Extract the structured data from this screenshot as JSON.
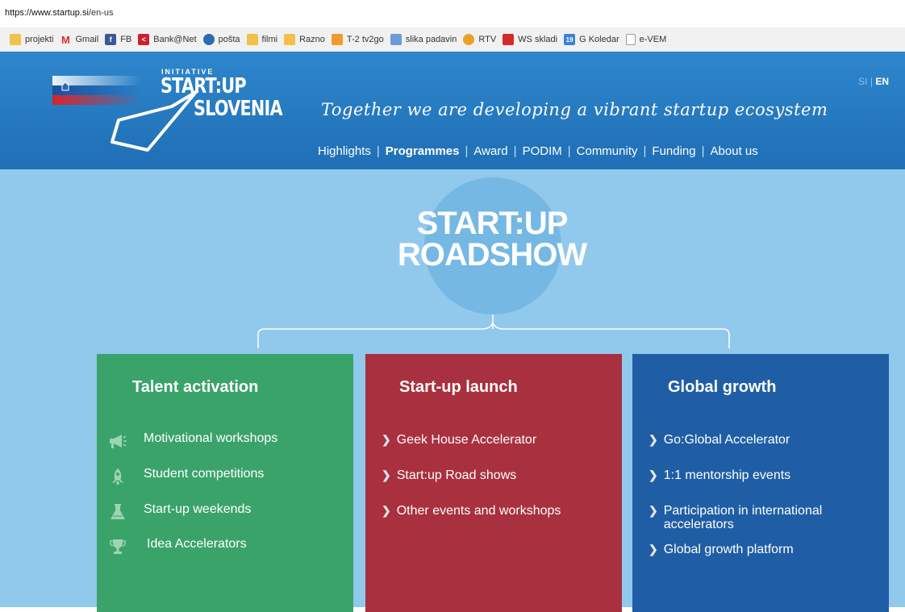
{
  "browser": {
    "url_host": "https://www.startup.si",
    "url_path": "/en-us",
    "bookmarks": [
      {
        "label": "projekti",
        "icon": "folder-icon",
        "color": "#f3c04a"
      },
      {
        "label": "Gmail",
        "icon": "gmail-icon",
        "color": "#d93025"
      },
      {
        "label": "FB",
        "icon": "facebook-icon",
        "color": "#3b5998"
      },
      {
        "label": "Bank@Net",
        "icon": "bank-icon",
        "color": "#cc2030"
      },
      {
        "label": "pošta",
        "icon": "mail-icon",
        "color": "#2a6bb2"
      },
      {
        "label": "filmi",
        "icon": "folder-icon",
        "color": "#f3c04a"
      },
      {
        "label": "Razno",
        "icon": "folder-icon",
        "color": "#f3c04a"
      },
      {
        "label": "T-2 tv2go",
        "icon": "tv-icon",
        "color": "#f29a2e"
      },
      {
        "label": "slika padavin",
        "icon": "weather-icon",
        "color": "#6b9bd8"
      },
      {
        "label": "RTV",
        "icon": "rtv-icon",
        "color": "#e8a227"
      },
      {
        "label": "WS skladi",
        "icon": "ws-icon",
        "color": "#d62a2a"
      },
      {
        "label": "G Koledar",
        "icon": "calendar-icon",
        "color": "#3b82d6"
      },
      {
        "label": "e-VEM",
        "icon": "page-icon",
        "color": "#ffffff"
      }
    ]
  },
  "header": {
    "initiative": "INITIATIVE",
    "logo_line1": "START:UP",
    "logo_line2": "SLOVENIA",
    "lang_si": "SI",
    "lang_sep": "|",
    "lang_en": "EN",
    "tagline": "Together we are developing a vibrant startup ecosystem",
    "nav": [
      "Highlights",
      "Programmes",
      "Award",
      "PODIM",
      "Community",
      "Funding",
      "About us"
    ],
    "nav_active": "Programmes"
  },
  "main": {
    "title_line1": "START:UP",
    "title_line2": "ROADSHOW",
    "panels": {
      "talent": {
        "title": "Talent activation",
        "items": [
          "Motivational workshops",
          "Student competitions",
          "Start-up weekends",
          "Idea Accelerators"
        ]
      },
      "launch": {
        "title": "Start-up launch",
        "items": [
          "Geek House Accelerator",
          "Start:up Road shows",
          "Other events and workshops"
        ]
      },
      "growth": {
        "title": "Global growth",
        "items": [
          "Go:Global Accelerator",
          "1:1 mentorship events",
          "Participation in international accelerators",
          "Global growth platform"
        ]
      }
    }
  },
  "colors": {
    "header_blue": "#2176bd",
    "background": "#91c9ec",
    "green": "#3aa36a",
    "red": "#a9303e",
    "blue": "#1f5ea4"
  }
}
